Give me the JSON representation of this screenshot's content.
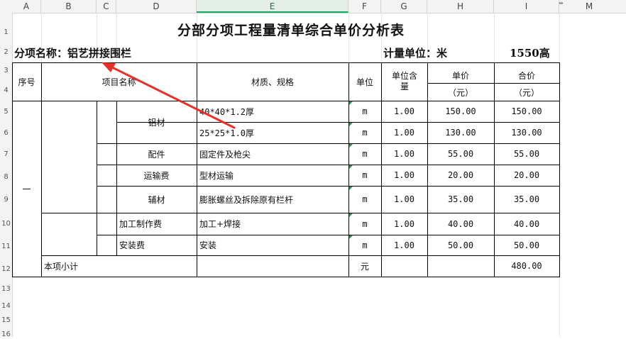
{
  "columns": [
    "A",
    "B",
    "C",
    "D",
    "E",
    "F",
    "G",
    "H",
    "I",
    "M"
  ],
  "rows": [
    "1",
    "2",
    "3",
    "4",
    "5",
    "6",
    "7",
    "8",
    "9",
    "10",
    "11",
    "12",
    "13",
    "14",
    "15",
    "16"
  ],
  "sheet": {
    "title": "分部分项工程量清单综合单价分析表",
    "item_label": "分项名称：铝艺拼接围栏",
    "unit_label": "计量单位：米",
    "height_label": "1550高"
  },
  "table": {
    "headers": {
      "seq": "序号",
      "item": "项目名称",
      "spec": "材质、规格",
      "unit": "单位",
      "qty": "单位含量",
      "price": "单价",
      "price_unit": "（元）",
      "total": "合价",
      "total_unit": "（元）"
    },
    "seq_value": "一",
    "groups": {
      "aluminum": "铝材",
      "fittings": "配件",
      "freight": "运输费",
      "aux": "辅材",
      "fabrication": "加工制作费",
      "install": "安装费"
    },
    "rows": [
      {
        "spec": "40*40*1.2厚",
        "unit": "m",
        "qty": "1.00",
        "price": "150.00",
        "total": "150.00"
      },
      {
        "spec": "25*25*1.0厚",
        "unit": "m",
        "qty": "1.00",
        "price": "130.00",
        "total": "130.00"
      },
      {
        "spec": "固定件及枪尖",
        "unit": "m",
        "qty": "1.00",
        "price": "55.00",
        "total": "55.00"
      },
      {
        "spec": "型材运输",
        "unit": "m",
        "qty": "1.00",
        "price": "20.00",
        "total": "20.00"
      },
      {
        "spec": "膨胀螺丝及拆除原有栏杆",
        "unit": "m",
        "qty": "1.00",
        "price": "35.00",
        "total": "35.00"
      },
      {
        "spec": "加工+焊接",
        "unit": "m",
        "qty": "1.00",
        "price": "40.00",
        "total": "40.00"
      },
      {
        "spec": "安装",
        "unit": "m",
        "qty": "1.00",
        "price": "50.00",
        "total": "50.00"
      }
    ],
    "subtotal": {
      "label": "本项小计",
      "unit": "元",
      "total": "480.00"
    }
  },
  "colors": {
    "arrow": "#e8302a",
    "grid": "#e6e6e6",
    "header_bg": "#f3f3f3",
    "selected_col": "#21a366"
  }
}
